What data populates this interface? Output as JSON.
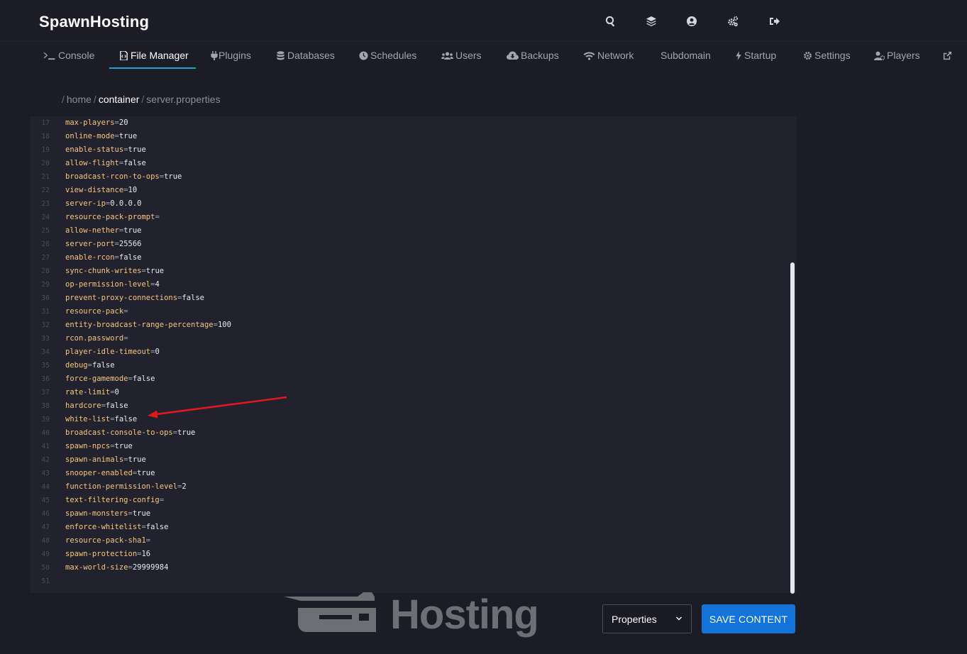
{
  "app": {
    "brand": "SpawnHosting"
  },
  "top_icons": [
    "search-icon",
    "layers-icon",
    "user-circle-icon",
    "cogs-icon",
    "sign-out-icon"
  ],
  "nav": {
    "tabs": [
      {
        "label": "Console",
        "icon": "terminal-icon"
      },
      {
        "label": "File Manager",
        "icon": "file-code-icon",
        "active": true
      },
      {
        "label": "Plugins",
        "icon": "plug-icon"
      },
      {
        "label": "Databases",
        "icon": "database-icon"
      },
      {
        "label": "Schedules",
        "icon": "clock-icon"
      },
      {
        "label": "Users",
        "icon": "users-icon"
      },
      {
        "label": "Backups",
        "icon": "cloud-download-icon"
      },
      {
        "label": "Network",
        "icon": "wifi-icon"
      },
      {
        "label": "Subdomain",
        "icon": ""
      },
      {
        "label": "Startup",
        "icon": "bolt-icon"
      },
      {
        "label": "Settings",
        "icon": "cogs-icon"
      },
      {
        "label": "Players",
        "icon": "user-cog-icon"
      }
    ],
    "external_icon": "external-link-icon"
  },
  "breadcrumb": {
    "sep": "/",
    "home": "home",
    "container": "container",
    "file": "server.properties"
  },
  "editor": {
    "lines": [
      {
        "n": "17",
        "key": "max-players",
        "val": "20"
      },
      {
        "n": "18",
        "key": "online-mode",
        "val": "true"
      },
      {
        "n": "19",
        "key": "enable-status",
        "val": "true"
      },
      {
        "n": "20",
        "key": "allow-flight",
        "val": "false"
      },
      {
        "n": "21",
        "key": "broadcast-rcon-to-ops",
        "val": "true"
      },
      {
        "n": "22",
        "key": "view-distance",
        "val": "10"
      },
      {
        "n": "23",
        "key": "server-ip",
        "val": "0.0.0.0"
      },
      {
        "n": "24",
        "key": "resource-pack-prompt",
        "val": ""
      },
      {
        "n": "25",
        "key": "allow-nether",
        "val": "true"
      },
      {
        "n": "26",
        "key": "server-port",
        "val": "25566"
      },
      {
        "n": "27",
        "key": "enable-rcon",
        "val": "false"
      },
      {
        "n": "28",
        "key": "sync-chunk-writes",
        "val": "true"
      },
      {
        "n": "29",
        "key": "op-permission-level",
        "val": "4"
      },
      {
        "n": "30",
        "key": "prevent-proxy-connections",
        "val": "false"
      },
      {
        "n": "31",
        "key": "resource-pack",
        "val": ""
      },
      {
        "n": "32",
        "key": "entity-broadcast-range-percentage",
        "val": "100"
      },
      {
        "n": "33",
        "key": "rcon.password",
        "val": ""
      },
      {
        "n": "34",
        "key": "player-idle-timeout",
        "val": "0"
      },
      {
        "n": "35",
        "key": "debug",
        "val": "false"
      },
      {
        "n": "36",
        "key": "force-gamemode",
        "val": "false"
      },
      {
        "n": "37",
        "key": "rate-limit",
        "val": "0"
      },
      {
        "n": "38",
        "key": "hardcore",
        "val": "false"
      },
      {
        "n": "39",
        "key": "white-list",
        "val": "false"
      },
      {
        "n": "40",
        "key": "broadcast-console-to-ops",
        "val": "true"
      },
      {
        "n": "41",
        "key": "spawn-npcs",
        "val": "true"
      },
      {
        "n": "42",
        "key": "spawn-animals",
        "val": "true"
      },
      {
        "n": "43",
        "key": "snooper-enabled",
        "val": "true"
      },
      {
        "n": "44",
        "key": "function-permission-level",
        "val": "2"
      },
      {
        "n": "45",
        "key": "text-filtering-config",
        "val": ""
      },
      {
        "n": "46",
        "key": "spawn-monsters",
        "val": "true"
      },
      {
        "n": "47",
        "key": "enforce-whitelist",
        "val": "false"
      },
      {
        "n": "48",
        "key": "resource-pack-sha1",
        "val": ""
      },
      {
        "n": "49",
        "key": "spawn-protection",
        "val": "16"
      },
      {
        "n": "50",
        "key": "max-world-size",
        "val": "29999984"
      },
      {
        "n": "51",
        "key": "",
        "val": ""
      }
    ],
    "highlighted_line": "39"
  },
  "watermark": {
    "text": "Hosting"
  },
  "footer": {
    "mode_select": "Properties",
    "save_label": "SAVE CONTENT"
  },
  "colors": {
    "accent": "#1fa2c7",
    "save_button": "#1373d8",
    "key": "#f6c77d",
    "arrow": "#e0191c"
  }
}
